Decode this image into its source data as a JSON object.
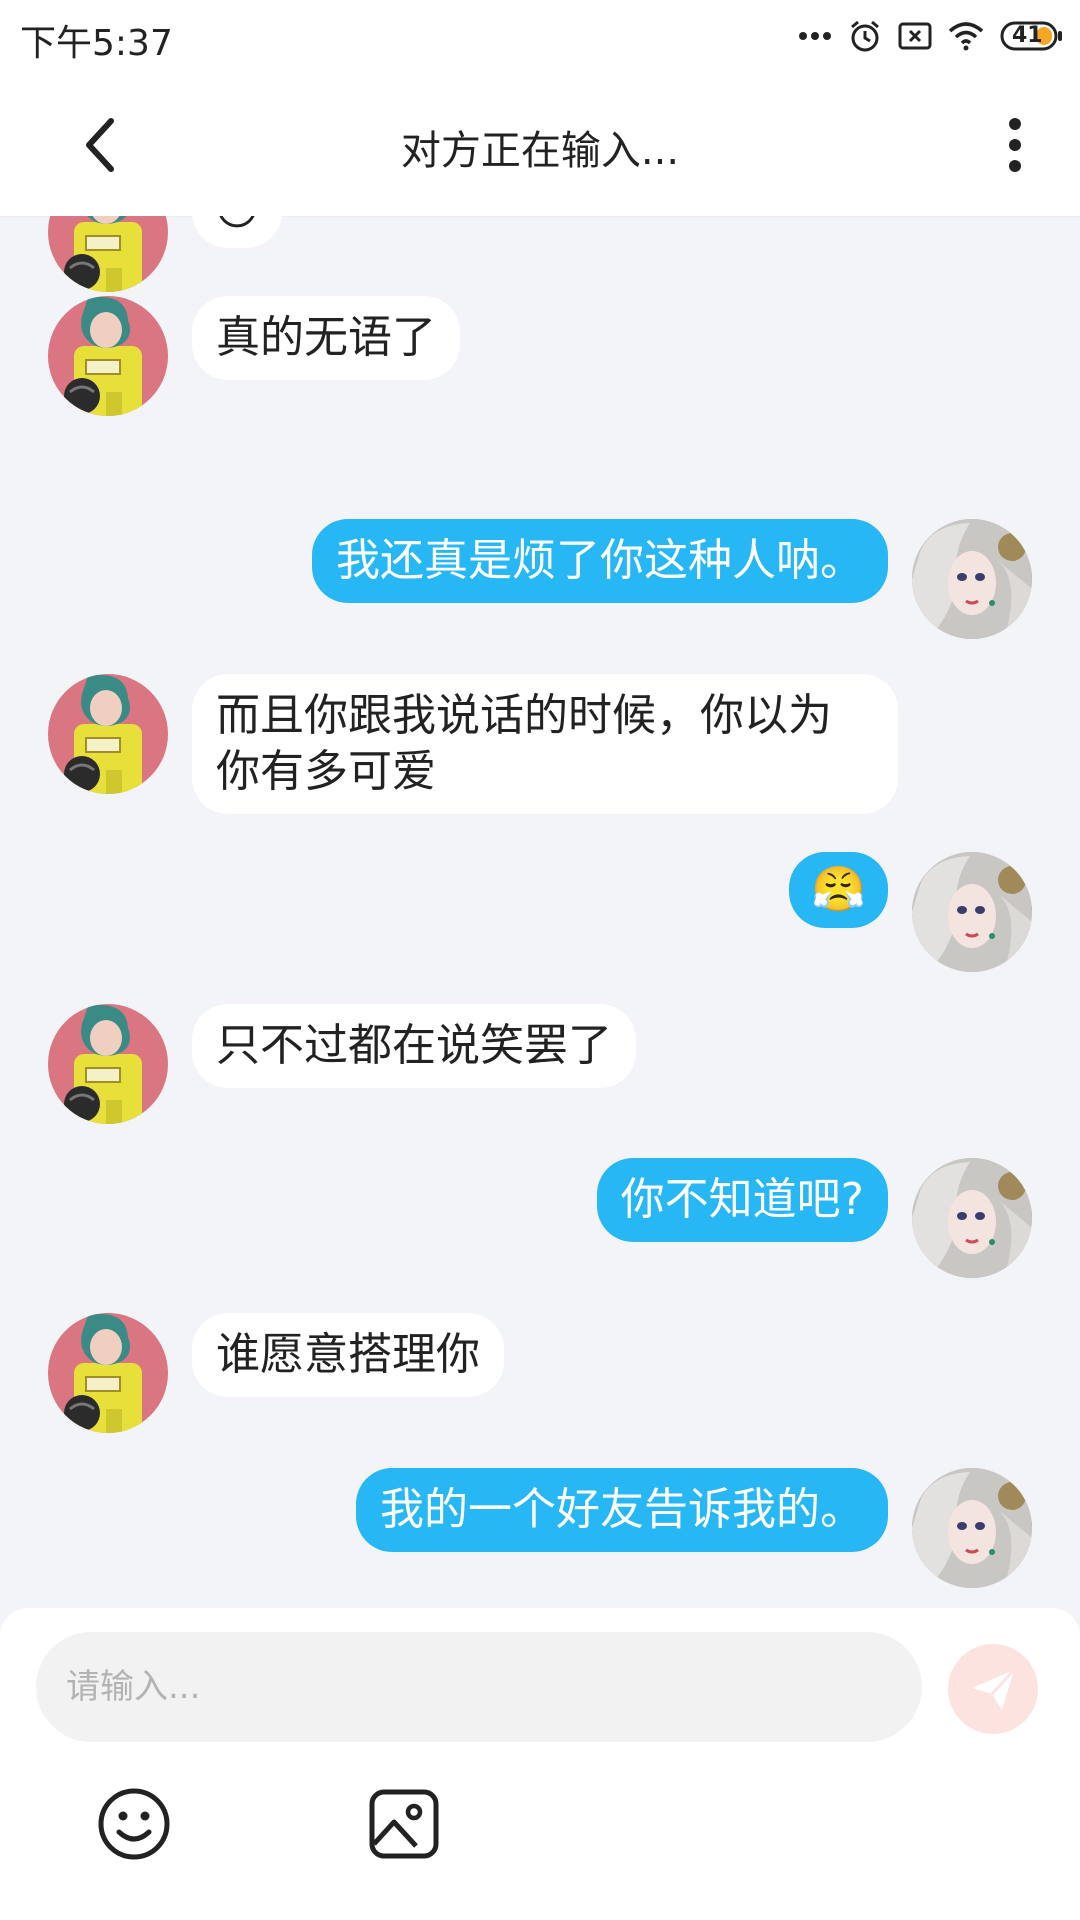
{
  "status_bar": {
    "time": "下午5:37",
    "battery_level": "41",
    "icons": [
      "more-dots-icon",
      "alarm-icon",
      "sim-off-icon",
      "wifi-icon",
      "battery-icon"
    ]
  },
  "header": {
    "title": "对方正在输入...",
    "back_icon": "chevron-left-icon",
    "more_icon": "vertical-dots-icon"
  },
  "colors": {
    "sent_bubble": "#27b7f5",
    "received_bubble": "#ffffff",
    "background": "#f3f4f8",
    "send_button": "#fde3e0"
  },
  "messages": [
    {
      "from": "other",
      "type": "emoji",
      "emoji": "😒"
    },
    {
      "from": "other",
      "type": "text",
      "text": "真的无语了"
    },
    {
      "from": "me",
      "type": "text",
      "text": "我还真是烦了你这种人呐。"
    },
    {
      "from": "other",
      "type": "text",
      "text": "而且你跟我说话的时候，你以为你有多可爱"
    },
    {
      "from": "me",
      "type": "emoji",
      "emoji": "😤"
    },
    {
      "from": "other",
      "type": "text",
      "text": "只不过都在说笑罢了"
    },
    {
      "from": "me",
      "type": "text",
      "text": "你不知道吧?"
    },
    {
      "from": "other",
      "type": "text",
      "text": "谁愿意搭理你"
    },
    {
      "from": "me",
      "type": "text",
      "text": "我的一个好友告诉我的。"
    }
  ],
  "composer": {
    "placeholder": "请输入...",
    "value": "",
    "send_icon": "paper-plane-icon",
    "tools": [
      "smiley-icon",
      "image-icon"
    ]
  }
}
